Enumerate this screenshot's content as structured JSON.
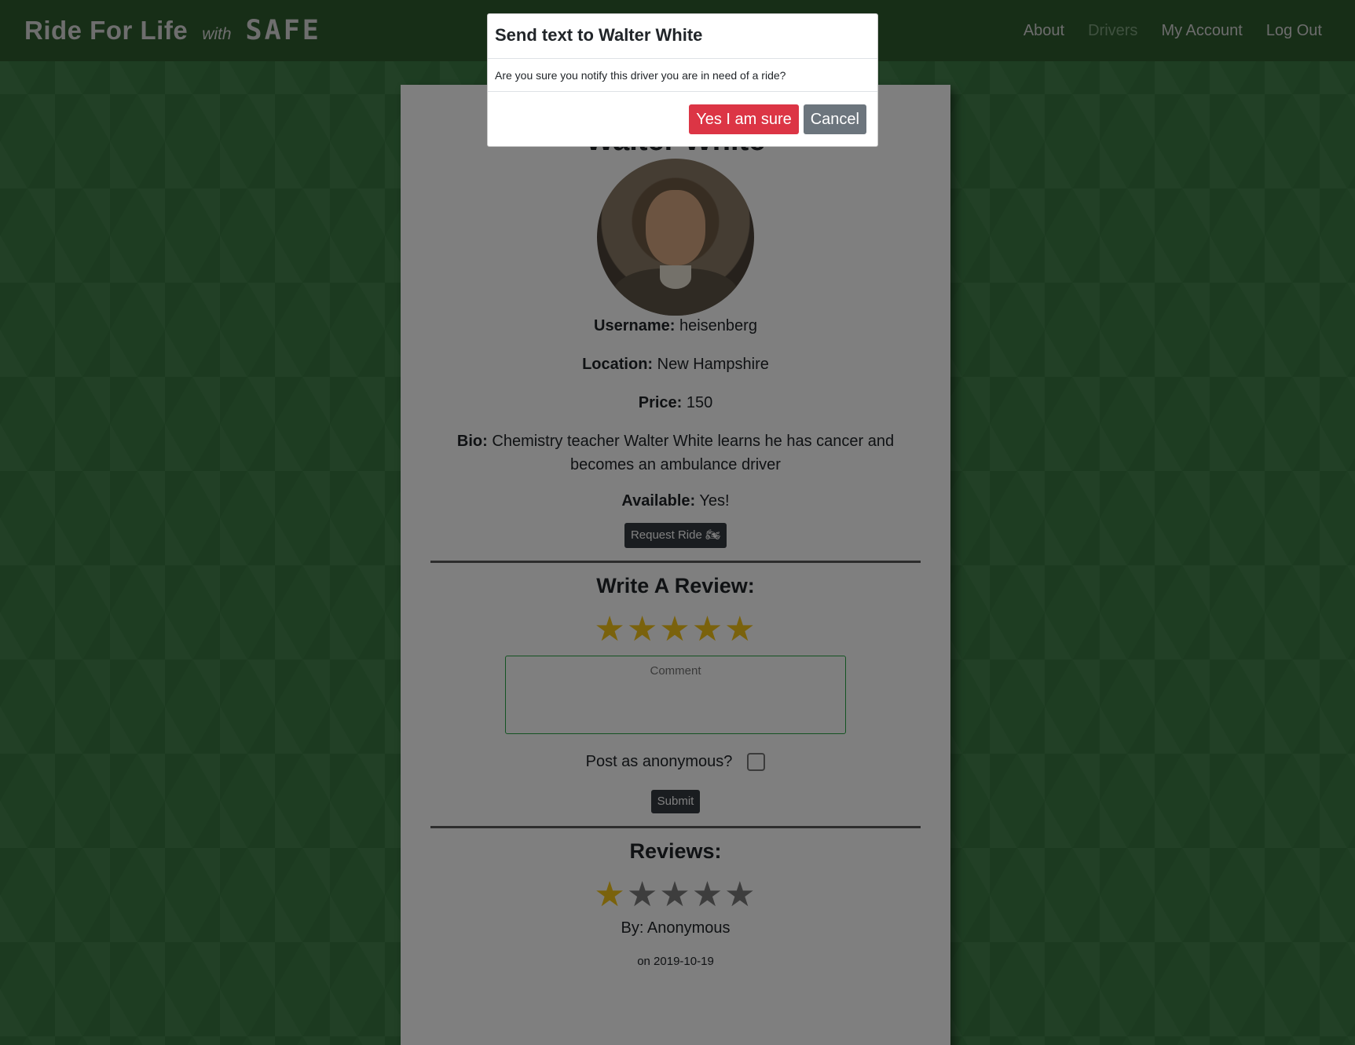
{
  "navbar": {
    "brand_title": "Ride For Life",
    "brand_with": "with",
    "brand_safe": "SAFE",
    "links": [
      "About",
      "Drivers",
      "My Account",
      "Log Out"
    ],
    "active_link": "Drivers"
  },
  "driver": {
    "name": "Walter White",
    "username_label": "Username:",
    "username": "heisenberg",
    "location_label": "Location:",
    "location": "New Hampshire",
    "price_label": "Price:",
    "price": "150",
    "bio_label": "Bio:",
    "bio": "Chemistry teacher Walter White learns he has cancer and becomes an ambulance driver",
    "available_label": "Available:",
    "available": "Yes!",
    "request_button": "Request Ride 🏍"
  },
  "write_review": {
    "title": "Write A Review:",
    "rating": 5,
    "max_rating": 5,
    "comment_placeholder": "Comment",
    "anonymous_label": "Post as anonymous?",
    "anonymous_checked": false,
    "submit_label": "Submit"
  },
  "reviews": {
    "title": "Reviews:",
    "items": [
      {
        "rating": 1,
        "max_rating": 5,
        "by": "By: Anonymous",
        "date": "on 2019-10-19"
      }
    ]
  },
  "modal": {
    "title": "Send text to Walter White",
    "body": "Are you sure you notify this driver you are in need of a ride?",
    "confirm_label": "Yes I am sure",
    "cancel_label": "Cancel"
  },
  "colors": {
    "navbar": "#2f5c2f",
    "background": "#3c7b45",
    "danger": "#dc3545",
    "secondary": "#6c757d",
    "star_on": "#f5c518"
  }
}
